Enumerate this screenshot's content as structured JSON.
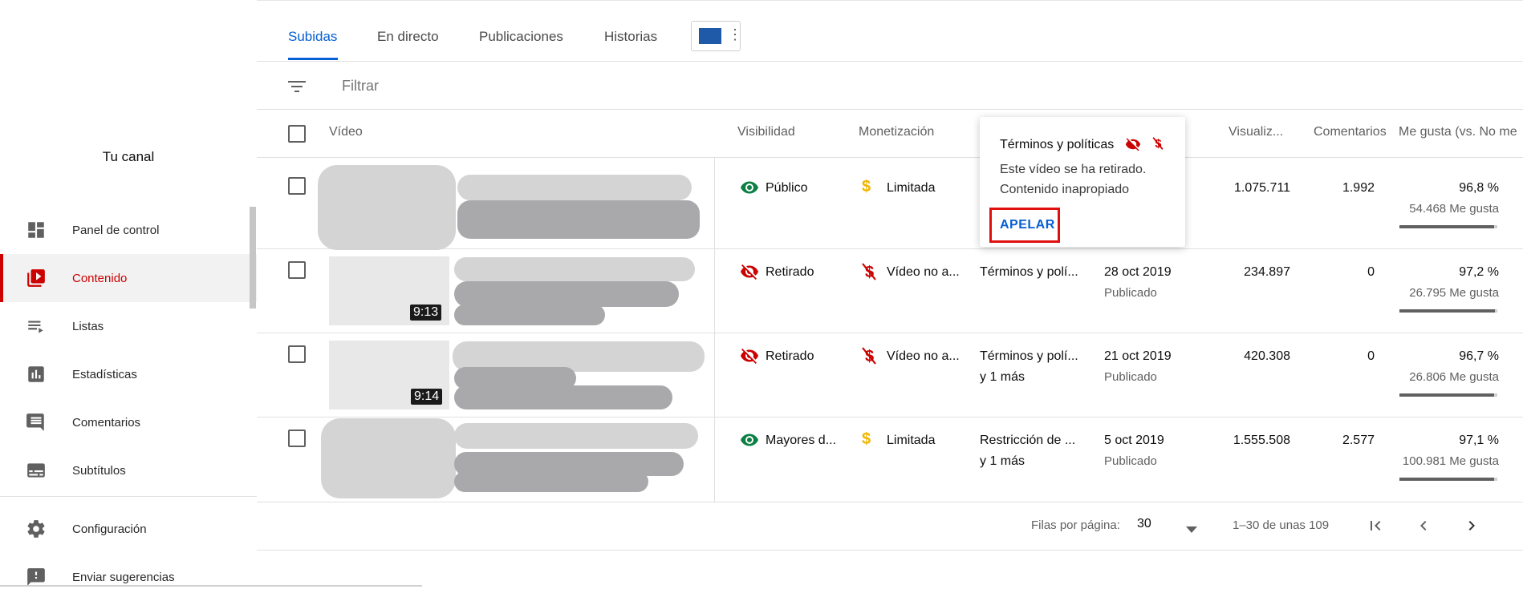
{
  "sidebar": {
    "channel_title": "Tu canal",
    "items": [
      {
        "label": "Panel de control",
        "icon": "dashboard-icon",
        "active": false
      },
      {
        "label": "Contenido",
        "icon": "content-icon",
        "active": true
      },
      {
        "label": "Listas",
        "icon": "playlist-icon",
        "active": false
      },
      {
        "label": "Estadísticas",
        "icon": "analytics-icon",
        "active": false
      },
      {
        "label": "Comentarios",
        "icon": "comments-icon",
        "active": false
      },
      {
        "label": "Subtítulos",
        "icon": "subtitles-icon",
        "active": false
      },
      {
        "label": "Configuración",
        "icon": "gear-icon",
        "active": false
      },
      {
        "label": "Enviar sugerencias",
        "icon": "feedback-icon",
        "active": false
      }
    ]
  },
  "tabs": [
    {
      "label": "Subidas",
      "active": true
    },
    {
      "label": "En directo",
      "active": false
    },
    {
      "label": "Publicaciones",
      "active": false
    },
    {
      "label": "Historias",
      "active": false
    }
  ],
  "filter": {
    "placeholder": "Filtrar"
  },
  "table": {
    "headers": {
      "video": "Vídeo",
      "visibility": "Visibilidad",
      "monetization": "Monetización",
      "views": "Visualiz...",
      "comments": "Comentarios",
      "likes": "Me gusta (vs. No me"
    },
    "rows": [
      {
        "visibility": "Público",
        "visibility_type": "public",
        "monetization": "Limitada",
        "monetization_type": "limited",
        "restrictions": "",
        "restrictions_more": "",
        "date": "",
        "date_status": "",
        "views": "1.075.711",
        "comments": "1.992",
        "likes_pct": "96,8 %",
        "likes_count": "54.468 Me gusta",
        "likes_ratio": 0.968,
        "duration": ""
      },
      {
        "visibility": "Retirado",
        "visibility_type": "removed",
        "monetization": "Vídeo no a...",
        "monetization_type": "off",
        "restrictions": "Términos y polí...",
        "restrictions_more": "",
        "date": "28 oct 2019",
        "date_status": "Publicado",
        "views": "234.897",
        "comments": "0",
        "likes_pct": "97,2 %",
        "likes_count": "26.795 Me gusta",
        "likes_ratio": 0.972,
        "duration": "9:13"
      },
      {
        "visibility": "Retirado",
        "visibility_type": "removed",
        "monetization": "Vídeo no a...",
        "monetization_type": "off",
        "restrictions": "Términos y polí...",
        "restrictions_more": "y 1 más",
        "date": "21 oct 2019",
        "date_status": "Publicado",
        "views": "420.308",
        "comments": "0",
        "likes_pct": "96,7 %",
        "likes_count": "26.806 Me gusta",
        "likes_ratio": 0.967,
        "duration": "9:14"
      },
      {
        "visibility": "Mayores d...",
        "visibility_type": "public",
        "monetization": "Limitada",
        "monetization_type": "limited",
        "restrictions": "Restricción de ...",
        "restrictions_more": "y 1 más",
        "date": "5 oct 2019",
        "date_status": "Publicado",
        "views": "1.555.508",
        "comments": "2.577",
        "likes_pct": "97,1 %",
        "likes_count": "100.981 Me gusta",
        "likes_ratio": 0.971,
        "duration": ""
      }
    ]
  },
  "popup": {
    "title": "Términos y políticas",
    "line1": "Este vídeo se ha retirado.",
    "line2": "Contenido inapropiado",
    "action": "APELAR"
  },
  "footer": {
    "rows_per_page_label": "Filas por página:",
    "rows_per_page_value": "30",
    "range": "1–30 de unas 109"
  },
  "colors": {
    "accent": "#065fd4",
    "brand_red": "#cc0000",
    "public_green": "#0b8043",
    "removed_red": "#cc0000",
    "money_yellow": "#f0b400"
  }
}
